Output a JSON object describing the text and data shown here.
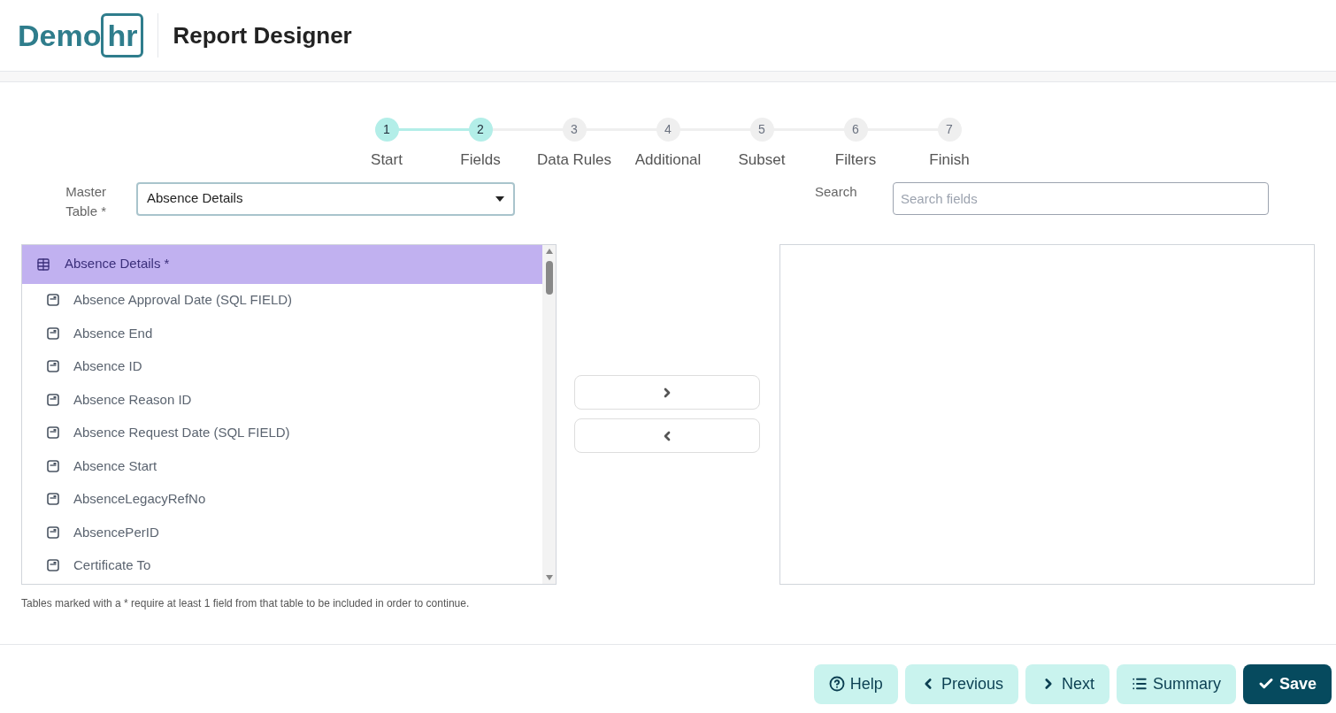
{
  "header": {
    "logo": {
      "part_1": "Demo",
      "part_2": "hr"
    },
    "title": "Report Designer"
  },
  "steps": [
    {
      "number": "1",
      "label": "Start",
      "done": true
    },
    {
      "number": "2",
      "label": "Fields",
      "done": true
    },
    {
      "number": "3",
      "label": "Data Rules",
      "done": false
    },
    {
      "number": "4",
      "label": "Additional",
      "done": false
    },
    {
      "number": "5",
      "label": "Subset",
      "done": false
    },
    {
      "number": "6",
      "label": "Filters",
      "done": false
    },
    {
      "number": "7",
      "label": "Finish",
      "done": false
    }
  ],
  "master_table": {
    "label": "Master Table *",
    "value": "Absence Details"
  },
  "search": {
    "label": "Search",
    "placeholder": "Search fields"
  },
  "field_tree": [
    {
      "label": "Absence Details *",
      "selected": true,
      "children": [
        {
          "label": "Absence Approval Date (SQL FIELD)",
          "selected": false
        },
        {
          "label": "Absence End",
          "selected": false
        },
        {
          "label": "Absence ID",
          "selected": false
        },
        {
          "label": "Absence Reason ID",
          "selected": false
        },
        {
          "label": "Absence Request Date (SQL FIELD)",
          "selected": false
        },
        {
          "label": "Absence Start",
          "selected": false
        },
        {
          "label": "AbsenceLegacyRefNo",
          "selected": false
        },
        {
          "label": "AbsencePerID",
          "selected": false
        },
        {
          "label": "Certificate To",
          "selected": false
        }
      ]
    }
  ],
  "note": "Tables marked with a * require at least 1 field from that table to be included in order to continue.",
  "footer_buttons": [
    {
      "kind": "help",
      "label": "Help"
    },
    {
      "kind": "previous",
      "label": "Previous"
    },
    {
      "kind": "next",
      "label": "Next"
    },
    {
      "kind": "summary",
      "label": "Summary"
    },
    {
      "kind": "save",
      "label": "Save"
    }
  ]
}
